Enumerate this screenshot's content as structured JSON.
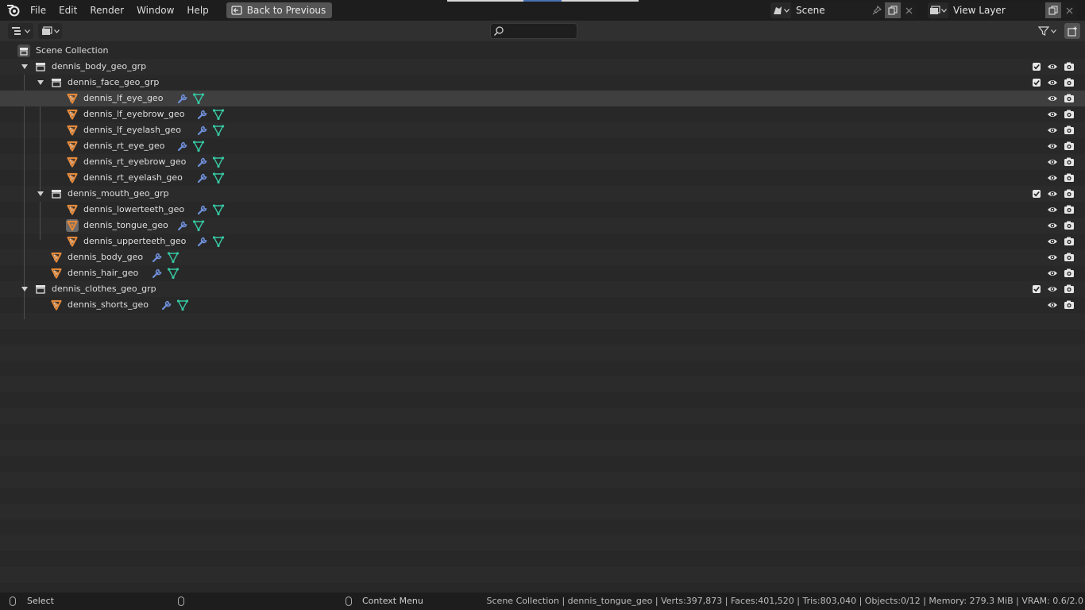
{
  "menu": {
    "items": [
      "File",
      "Edit",
      "Render",
      "Window",
      "Help"
    ],
    "back_button": "Back to Previous"
  },
  "scene": {
    "label": "Scene"
  },
  "view_layer": {
    "label": "View Layer"
  },
  "search": {
    "value": "",
    "placeholder": ""
  },
  "outliner": {
    "root": "Scene Collection",
    "rows": [
      {
        "label": "dennis_body_geo_grp",
        "kind": "collection",
        "depth": 1,
        "expanded": true,
        "checkbox": true
      },
      {
        "label": "dennis_face_geo_grp",
        "kind": "collection",
        "depth": 2,
        "expanded": true,
        "checkbox": true
      },
      {
        "label": "dennis_lf_eye_geo",
        "kind": "mesh",
        "depth": 3,
        "expanded": false,
        "selected": true
      },
      {
        "label": "dennis_lf_eyebrow_geo",
        "kind": "mesh",
        "depth": 3,
        "expanded": false
      },
      {
        "label": "dennis_lf_eyelash_geo",
        "kind": "mesh",
        "depth": 3,
        "expanded": false
      },
      {
        "label": "dennis_rt_eye_geo",
        "kind": "mesh",
        "depth": 3,
        "expanded": false
      },
      {
        "label": "dennis_rt_eyebrow_geo",
        "kind": "mesh",
        "depth": 3,
        "expanded": false
      },
      {
        "label": "dennis_rt_eyelash_geo",
        "kind": "mesh",
        "depth": 3,
        "expanded": false
      },
      {
        "label": "dennis_mouth_geo_grp",
        "kind": "collection",
        "depth": 2,
        "expanded": true,
        "checkbox": true
      },
      {
        "label": "dennis_lowerteeth_geo",
        "kind": "mesh",
        "depth": 3,
        "expanded": false
      },
      {
        "label": "dennis_tongue_geo",
        "kind": "mesh",
        "depth": 3,
        "expanded": false,
        "active": true
      },
      {
        "label": "dennis_upperteeth_geo",
        "kind": "mesh",
        "depth": 3,
        "expanded": false
      },
      {
        "label": "dennis_body_geo",
        "kind": "mesh",
        "depth": 2,
        "expanded": false
      },
      {
        "label": "dennis_hair_geo",
        "kind": "mesh",
        "depth": 2,
        "expanded": false
      },
      {
        "label": "dennis_clothes_geo_grp",
        "kind": "collection",
        "depth": 1,
        "expanded": true,
        "checkbox": true
      },
      {
        "label": "dennis_shorts_geo",
        "kind": "mesh",
        "depth": 2,
        "expanded": false
      }
    ]
  },
  "status": {
    "select": "Select",
    "context_menu": "Context Menu",
    "stats": "Scene Collection | dennis_tongue_geo | Verts:397,873 | Faces:401,520 | Tris:803,040 | Objects:0/12 | Memory: 279.3 MiB | VRAM: 0.6/2.0"
  },
  "colors": {
    "mesh_icon": "#e2883a",
    "modifier_icon": "#6f8fd9",
    "data_icon": "#36c7a2",
    "selected_row": "#3f3f3f",
    "accent": "#4772b3"
  },
  "icons": {
    "logo": "blender-logo-icon",
    "collection": "collection-icon",
    "mesh": "mesh-object-icon",
    "modifier": "wrench-icon",
    "mesh_data": "mesh-data-icon",
    "visibility": "eye-icon",
    "render": "camera-icon",
    "search": "search-icon",
    "filter": "funnel-icon"
  }
}
